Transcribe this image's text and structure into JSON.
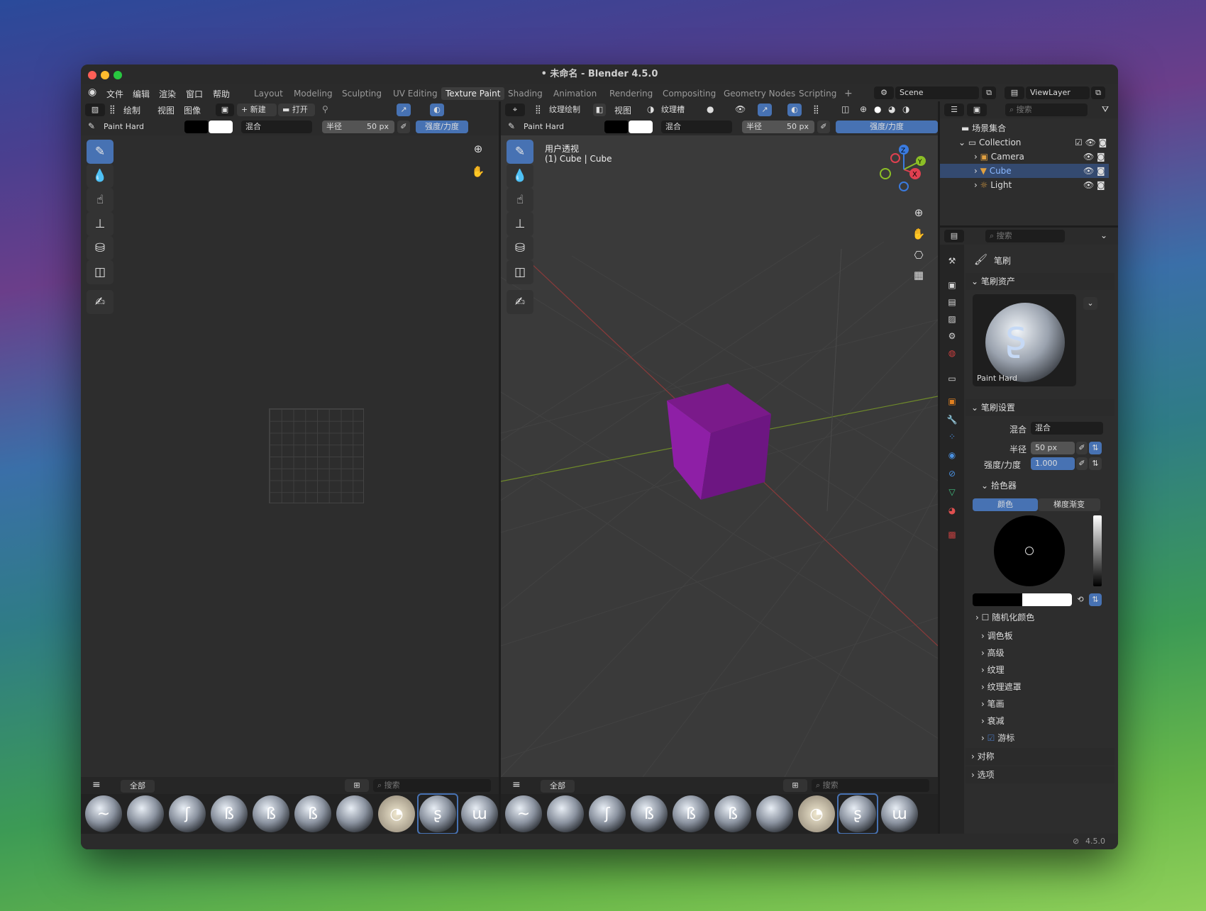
{
  "window": {
    "title": "• 未命名 - Blender 4.5.0"
  },
  "menu": [
    "文件",
    "编辑",
    "渲染",
    "窗口",
    "帮助"
  ],
  "workspaces": [
    "Layout",
    "Modeling",
    "Sculpting",
    "UV Editing",
    "Texture Paint",
    "Shading",
    "Animation",
    "Rendering",
    "Compositing",
    "Geometry Nodes",
    "Scripting",
    "+"
  ],
  "scene": {
    "name": "Scene",
    "view_layer": "ViewLayer"
  },
  "left_editor": {
    "menus": [
      "绘制",
      "视图",
      "图像"
    ],
    "new_label": "新建",
    "open_label": "打开",
    "brush": "Paint Hard",
    "blend": "混合",
    "radius_label": "半径",
    "radius_value": "50 px",
    "strength_label": "强度/力度"
  },
  "viewport": {
    "mode": "纹理绘制",
    "view_menu": "视图",
    "slot": "纹理槽",
    "brush": "Paint Hard",
    "blend": "混合",
    "radius_label": "半径",
    "radius_value": "50 px",
    "strength_label": "强度/力度",
    "view_name": "用户透视",
    "object_info": "(1) Cube | Cube",
    "axes": {
      "x": "X",
      "y": "Y",
      "z": "Z"
    }
  },
  "asset_shelf": {
    "tab": "全部",
    "search_placeholder": "搜索"
  },
  "outliner": {
    "search_placeholder": "搜索",
    "root": "场景集合",
    "collection": "Collection",
    "items": [
      "Camera",
      "Cube",
      "Light"
    ]
  },
  "properties": {
    "search_placeholder": "搜索",
    "title": "笔刷",
    "asset_section": "笔刷资产",
    "brush_name": "Paint Hard",
    "settings_section": "笔刷设置",
    "blend_label": "混合",
    "blend_value": "混合",
    "radius_label": "半径",
    "radius_value": "50 px",
    "strength_label": "强度/力度",
    "strength_value": "1.000",
    "picker_section": "拾色器",
    "tab_color": "颜色",
    "tab_gradient": "梯度渐变",
    "random_color": "随机化颜色",
    "subsections": [
      "调色板",
      "高级",
      "纹理",
      "纹理遮罩",
      "笔画",
      "衰减",
      "游标"
    ],
    "symmetry": "对称",
    "options": "选项"
  },
  "status": {
    "version": "4.5.0"
  }
}
